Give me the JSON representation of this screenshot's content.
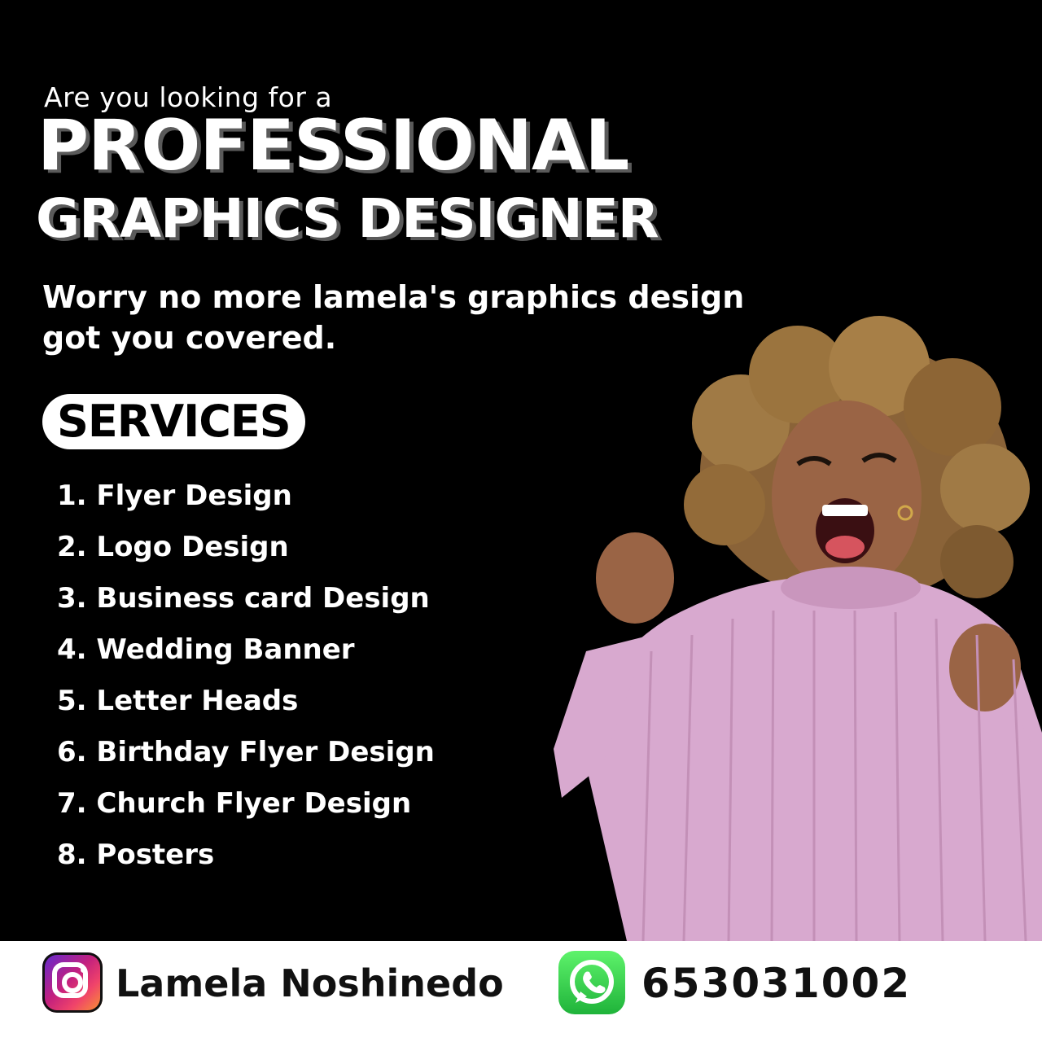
{
  "header": {
    "kicker": "Are you looking for a",
    "headline_line1": "PROFESSIONAL",
    "headline_line2": "GRAPHICS DESIGNER",
    "tagline": "Worry no more lamela's graphics design got you covered."
  },
  "services": {
    "title": "SERVICES",
    "items": [
      "1. Flyer Design",
      "2. Logo Design",
      "3. Business card Design",
      "4. Wedding Banner",
      "5. Letter Heads",
      "6. Birthday Flyer Design",
      "7. Church Flyer Design",
      "8. Posters"
    ]
  },
  "footer": {
    "instagram_icon": "instagram-icon",
    "instagram_handle": "Lamela Noshinedo",
    "whatsapp_icon": "whatsapp-icon",
    "phone": "653031002"
  },
  "colors": {
    "background": "#000000",
    "text_primary": "#ffffff",
    "footer_background": "#ffffff",
    "sweater_pink": "#d9a8cf",
    "whatsapp_green": "#2bc041"
  }
}
